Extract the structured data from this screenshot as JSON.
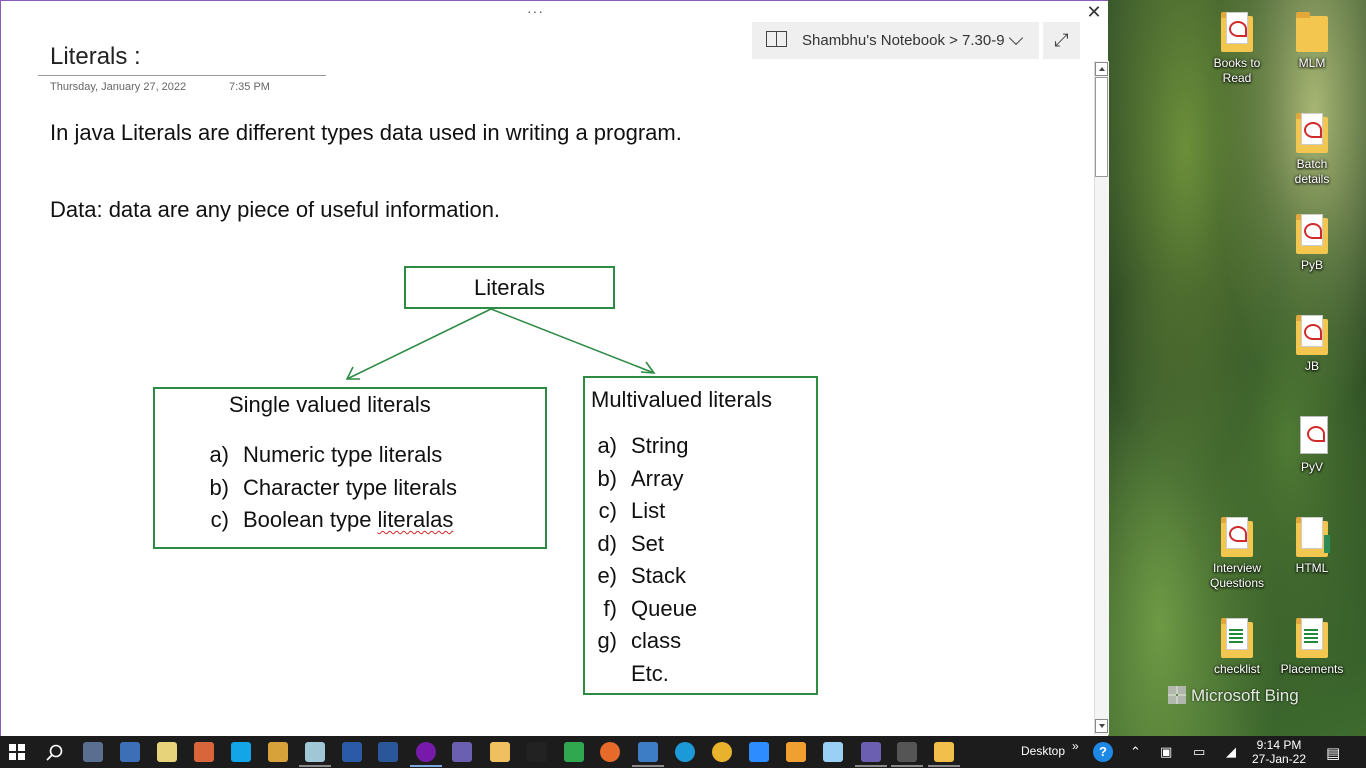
{
  "window": {
    "grip": "···",
    "close": "✕",
    "expand": "⤢",
    "breadcrumb": "Shambhu's Notebook > 7.30-9"
  },
  "page": {
    "title": "Literals :",
    "date": "Thursday, January 27, 2022",
    "time": "7:35 PM",
    "para1": "In java Literals are different types data used in writing a program.",
    "para2": "Data: data are any piece of useful information."
  },
  "diagram": {
    "root": "Literals",
    "single": {
      "title": "Single valued literals",
      "items": [
        {
          "marker": "a)",
          "text": "Numeric type literals"
        },
        {
          "marker": "b)",
          "text": "Character type literals"
        },
        {
          "marker": "c)",
          "text_plain": "Boolean type ",
          "text_flagged": "literalas"
        }
      ]
    },
    "multi": {
      "title": "Multivalued literals",
      "items": [
        {
          "marker": "a)",
          "text": "String"
        },
        {
          "marker": "b)",
          "text": "Array"
        },
        {
          "marker": "c)",
          "text": "List"
        },
        {
          "marker": "d)",
          "text": "Set"
        },
        {
          "marker": "e)",
          "text": "Stack"
        },
        {
          "marker": "f)",
          "text": "Queue"
        },
        {
          "marker": "g)",
          "text": "class"
        },
        {
          "marker": "",
          "text": "Etc."
        }
      ]
    },
    "line_color": "#2e8b44"
  },
  "desktop": {
    "icons": [
      {
        "label": "Books to Read",
        "type": "folder-pdf"
      },
      {
        "label": "MLM",
        "type": "folder"
      },
      {
        "label": "Batch details",
        "type": "folder-pdf"
      },
      {
        "label": "PyB",
        "type": "folder-pdf"
      },
      {
        "label": "JB",
        "type": "folder-pdf"
      },
      {
        "label": "PyV",
        "type": "pdf"
      },
      {
        "label": "Interview Questions",
        "type": "folder-pdf"
      },
      {
        "label": "HTML",
        "type": "folder-green"
      },
      {
        "label": "checklist",
        "type": "folder-xls"
      },
      {
        "label": "Placements",
        "type": "folder-xls"
      }
    ],
    "watermark": "Microsoft Bing"
  },
  "taskbar": {
    "desktop_label": "Desktop",
    "chevron": "»",
    "time": "9:14 PM",
    "date": "27-Jan-22",
    "apps": [
      {
        "name": "calculator",
        "color": "#5a6f8f"
      },
      {
        "name": "keyboard",
        "color": "#3c6fb5"
      },
      {
        "name": "notepad",
        "color": "#e6d37a"
      },
      {
        "name": "paint",
        "color": "#d9653b"
      },
      {
        "name": "skype",
        "color": "#12a5e8"
      },
      {
        "name": "word-doc",
        "color": "#d8a23a"
      },
      {
        "name": "notepad2",
        "color": "#9fc7d6"
      },
      {
        "name": "app-blue",
        "color": "#2b5aa6"
      },
      {
        "name": "word",
        "color": "#2b579a"
      },
      {
        "name": "onenote",
        "color": "#7719aa"
      },
      {
        "name": "media",
        "color": "#6a5fb0"
      },
      {
        "name": "image-editor",
        "color": "#f0c060"
      },
      {
        "name": "pycharm",
        "color": "#222222"
      },
      {
        "name": "refresh",
        "color": "#2fa84f"
      },
      {
        "name": "firefox",
        "color": "#e66b2a"
      },
      {
        "name": "remote",
        "color": "#3d7dc6"
      },
      {
        "name": "edge",
        "color": "#1c9ad8"
      },
      {
        "name": "chrome",
        "color": "#e8b22c"
      },
      {
        "name": "zoom",
        "color": "#2d8cff"
      },
      {
        "name": "settings-app",
        "color": "#f0a030"
      },
      {
        "name": "snowflake",
        "color": "#9ad0f5"
      },
      {
        "name": "media2",
        "color": "#6a5fb0"
      },
      {
        "name": "terminal",
        "color": "#555555"
      },
      {
        "name": "file-explorer",
        "color": "#f2c04a"
      }
    ]
  }
}
